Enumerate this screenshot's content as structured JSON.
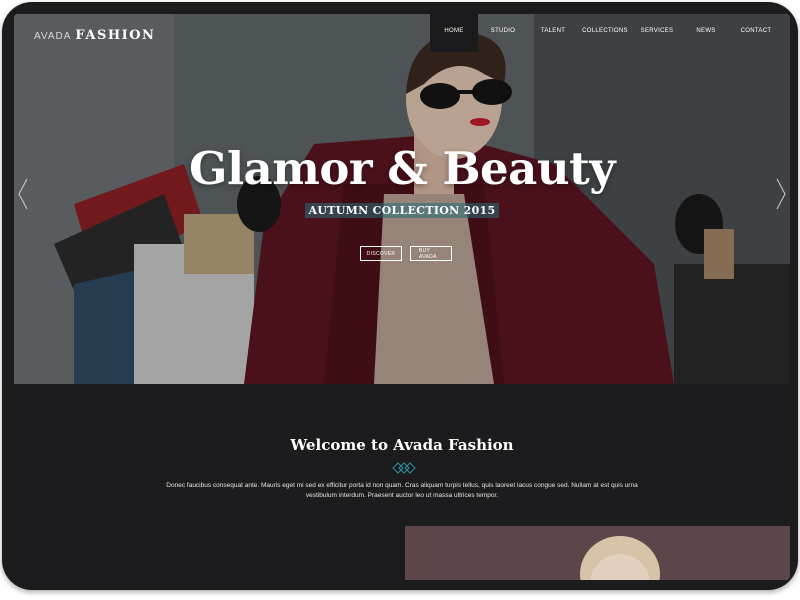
{
  "logo": {
    "light": "AVADA",
    "bold": "FASHION"
  },
  "nav": {
    "items": [
      {
        "label": "HOME",
        "active": true
      },
      {
        "label": "STUDIO",
        "active": false
      },
      {
        "label": "TALENT",
        "active": false
      },
      {
        "label": "COLLECTIONS",
        "active": false
      },
      {
        "label": "SERVICES",
        "active": false
      },
      {
        "label": "NEWS",
        "active": false
      },
      {
        "label": "CONTACT",
        "active": false
      }
    ]
  },
  "hero": {
    "title": "Glamor & Beauty",
    "subtitle": "AUTUMN COLLECTION 2015",
    "buttons": [
      "DISCOVER",
      "BUY AVADA"
    ],
    "prev_icon": "chevron-left-icon",
    "next_icon": "chevron-right-icon"
  },
  "welcome": {
    "title": "Welcome to Avada Fashion",
    "divider_icon": "diamond-divider-icon",
    "text": "Donec faucibus consequat ante. Mauris eget mi sed ex efficitur porta id non quam. Cras aliquam turpis tellus, quis laoreet lacus congue sed. Nullam at est quis urna vestibulum interdum. Praesent auctor leo ut massa ultrices tempor."
  },
  "colors": {
    "frame": "#1c1c1e",
    "background": "#1b1b1d",
    "accent": "#2f8fa0",
    "text": "#ffffff"
  }
}
